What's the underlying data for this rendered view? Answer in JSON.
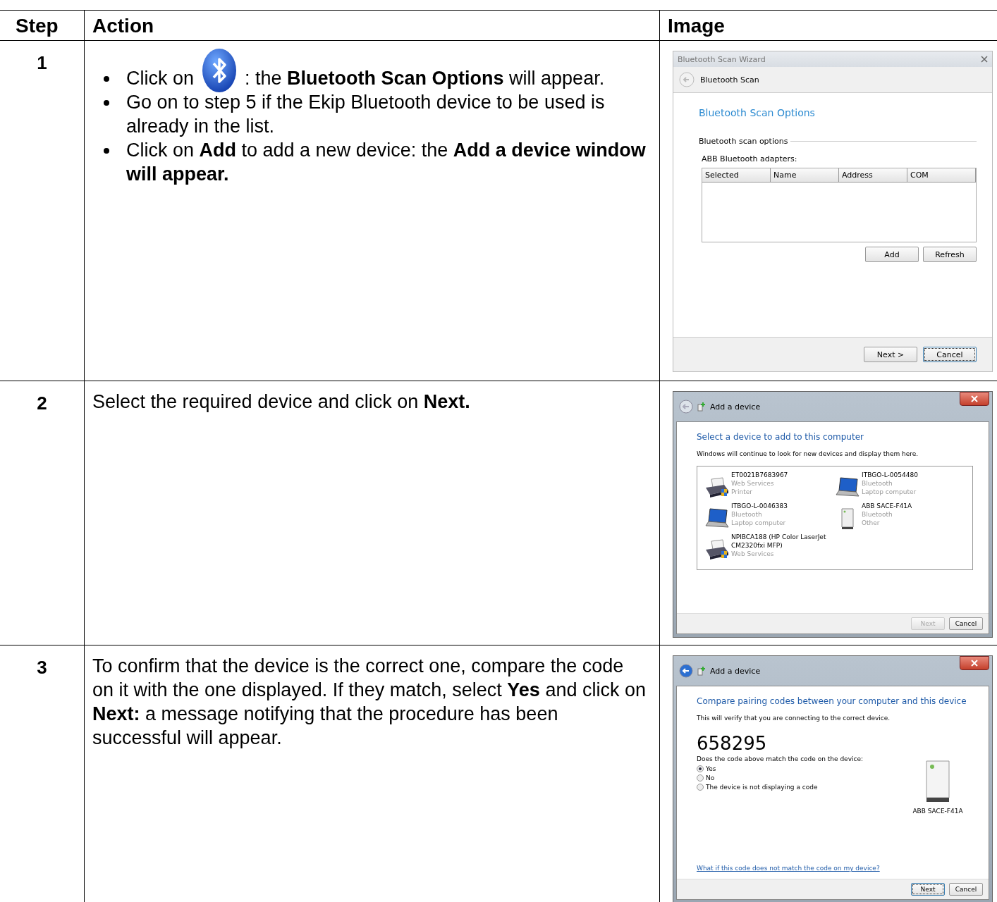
{
  "table": {
    "columns": [
      "Step",
      "Action",
      "Image"
    ],
    "rows": [
      {
        "step": "1",
        "bullets": [
          {
            "kind": "icon_text",
            "before": "Click on",
            "text": ": the **Bluetooth Scan Options** will appear."
          },
          {
            "kind": "text",
            "text": "Go on to step 5 if the Ekip Bluetooth device to be used is already in the list."
          },
          {
            "kind": "text",
            "text": "Click on **Add** to add a new device: the **Add a device window will appear.**"
          }
        ],
        "window": {
          "kind": "scan_wizard",
          "title": "Bluetooth Scan Wizard",
          "header": "Bluetooth Scan",
          "heading": "Bluetooth Scan Options",
          "group": "Bluetooth scan options",
          "label": "ABB Bluetooth adapters:",
          "columns": [
            "Selected",
            "Name",
            "Address",
            "COM"
          ],
          "buttons": [
            "Add",
            "Refresh"
          ],
          "footer_buttons": [
            {
              "label": "Next >",
              "disabled": false,
              "focused": false
            },
            {
              "label": "Cancel",
              "disabled": false,
              "focused": true
            }
          ]
        }
      },
      {
        "step": "2",
        "text": "Select the required device and click on **Next.**",
        "window": {
          "kind": "device_list",
          "title": "Add a device",
          "heading": "Select a device to add to this computer",
          "subtext": "Windows will continue to look for new devices and display them here.",
          "devices": [
            {
              "kind": "printer",
              "name": "ET0021B7683967",
              "lines": [
                "Web Services",
                "Printer"
              ]
            },
            {
              "kind": "laptop",
              "name": "ITBGO-L-0054480",
              "lines": [
                "Bluetooth",
                "Laptop computer"
              ]
            },
            {
              "kind": "laptop",
              "name": "ITBGO-L-0046383",
              "lines": [
                "Bluetooth",
                "Laptop computer"
              ]
            },
            {
              "kind": "tower",
              "name": "ABB SACE-F41A",
              "lines": [
                "Bluetooth",
                "Other"
              ]
            },
            {
              "kind": "printer",
              "name": "NPIBCA188 (HP Color LaserJet CM2320fxi MFP)",
              "lines": [
                "Web Services"
              ]
            }
          ],
          "footer_buttons": [
            {
              "label": "Next",
              "disabled": true,
              "focused": false
            },
            {
              "label": "Cancel",
              "disabled": false,
              "focused": false
            }
          ]
        }
      },
      {
        "step": "3",
        "text": "To confirm that the device is the correct one, compare the code on it with the one displayed. If they match, select **Yes** and click on **Next:** a message notifying that the procedure has been successful will appear.",
        "window": {
          "kind": "pairing",
          "title": "Add a device",
          "heading": "Compare pairing codes between your computer and this device",
          "subtext": "This will verify that you are connecting to the correct device.",
          "code": "658295",
          "question": "Does the code above match the code on the device:",
          "options": [
            {
              "label": "Yes",
              "selected": true
            },
            {
              "label": "No",
              "selected": false
            },
            {
              "label": "The device is not displaying a code",
              "selected": false
            }
          ],
          "device_label": "ABB SACE-F41A",
          "link": "What if this code does not match the code on my device?",
          "footer_buttons": [
            {
              "label": "Next",
              "disabled": false,
              "focused": true
            },
            {
              "label": "Cancel",
              "disabled": false,
              "focused": false
            }
          ]
        }
      }
    ]
  }
}
